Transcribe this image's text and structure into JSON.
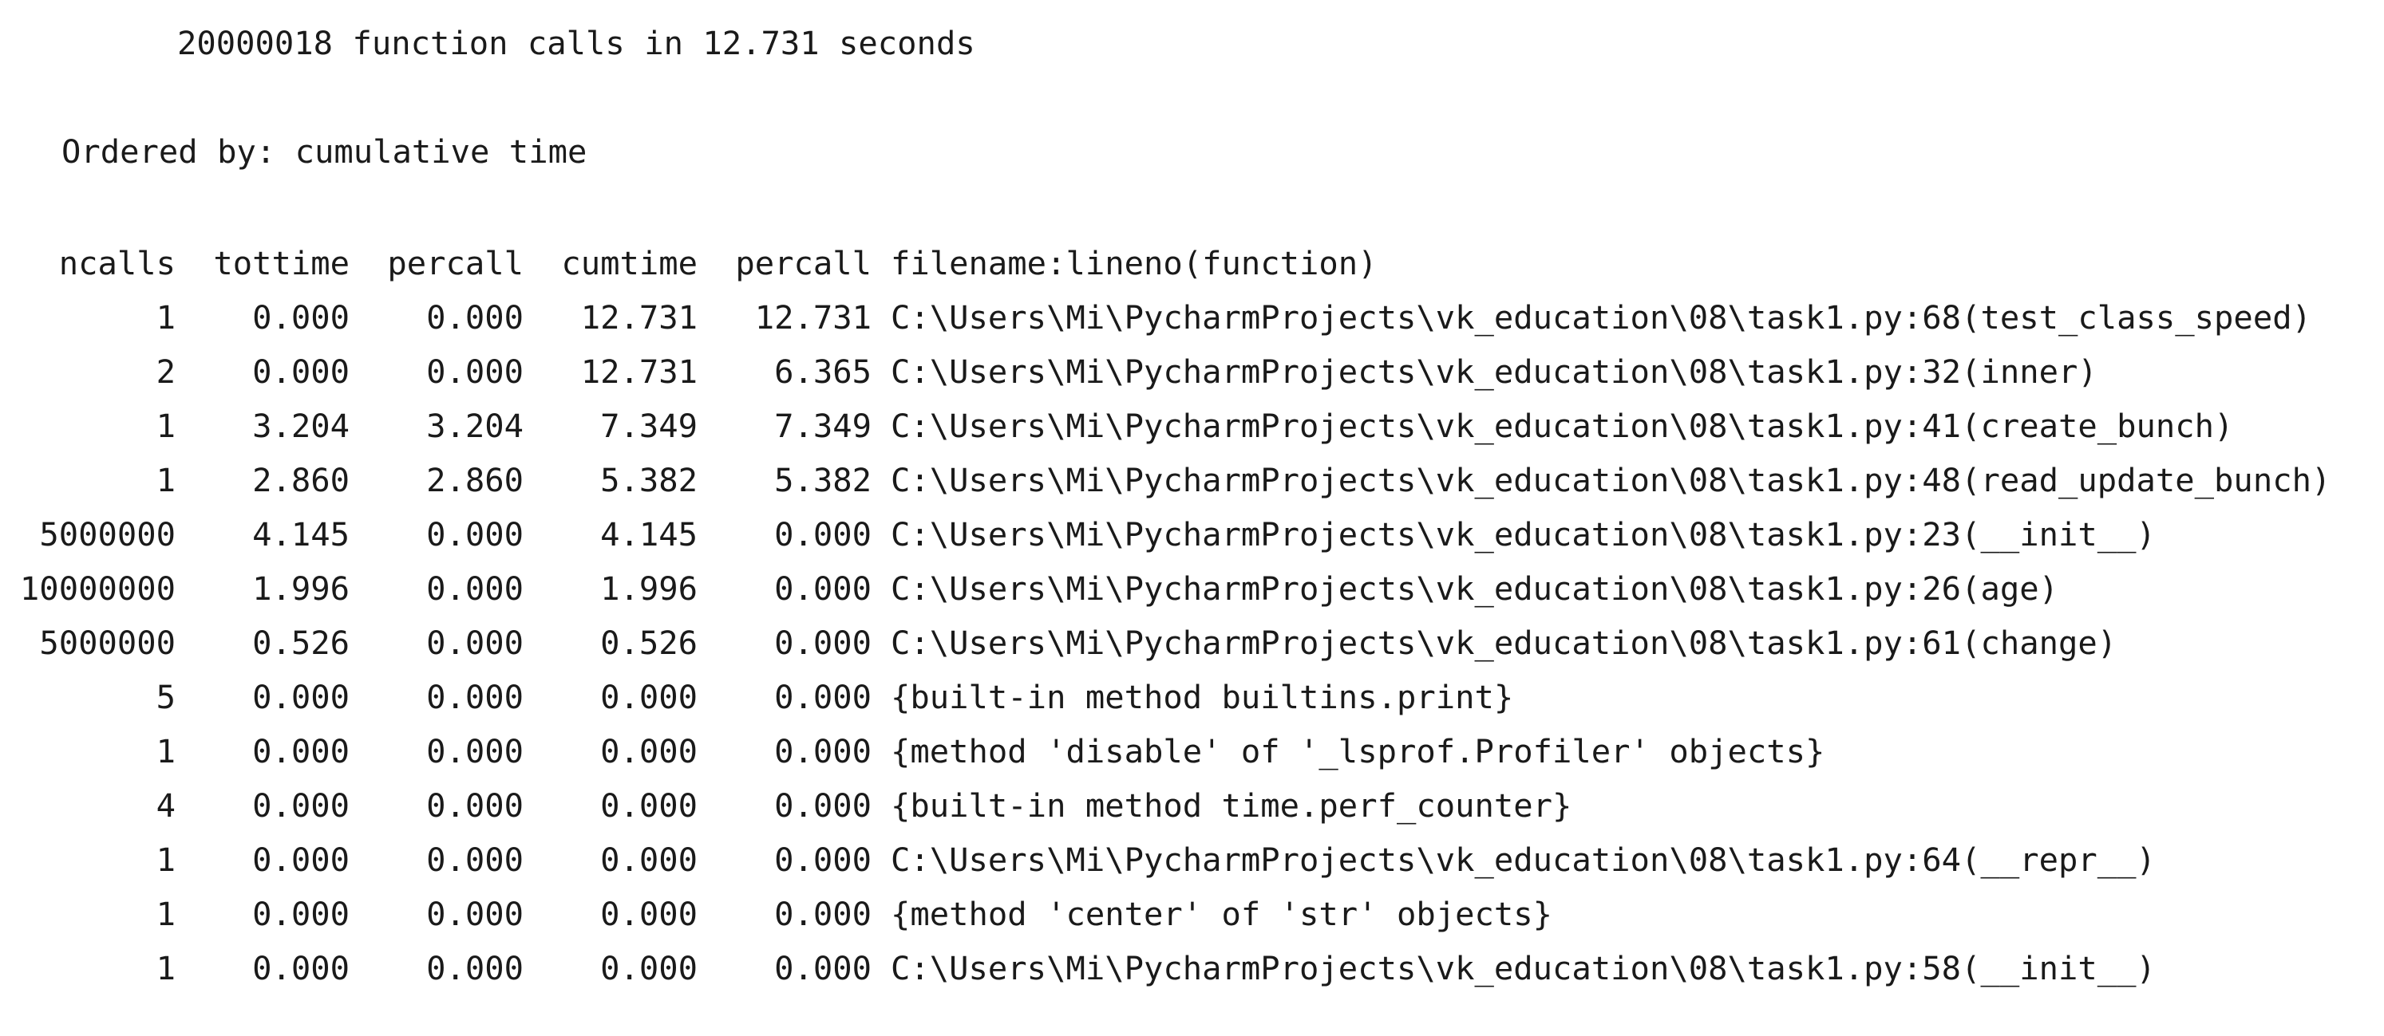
{
  "summary": {
    "text": "20000018 function calls in 12.731 seconds"
  },
  "ordered": {
    "text": "Ordered by: cumulative time"
  },
  "table": {
    "headers": [
      "ncalls",
      "tottime",
      "percall",
      "cumtime",
      "percall",
      "filename:lineno(function)"
    ],
    "rows": [
      [
        "1",
        "0.000",
        "0.000",
        "12.731",
        "12.731",
        "C:\\Users\\Mi\\PycharmProjects\\vk_education\\08\\task1.py:68(test_class_speed)"
      ],
      [
        "2",
        "0.000",
        "0.000",
        "12.731",
        "6.365",
        "C:\\Users\\Mi\\PycharmProjects\\vk_education\\08\\task1.py:32(inner)"
      ],
      [
        "1",
        "3.204",
        "3.204",
        "7.349",
        "7.349",
        "C:\\Users\\Mi\\PycharmProjects\\vk_education\\08\\task1.py:41(create_bunch)"
      ],
      [
        "1",
        "2.860",
        "2.860",
        "5.382",
        "5.382",
        "C:\\Users\\Mi\\PycharmProjects\\vk_education\\08\\task1.py:48(read_update_bunch)"
      ],
      [
        "5000000",
        "4.145",
        "0.000",
        "4.145",
        "0.000",
        "C:\\Users\\Mi\\PycharmProjects\\vk_education\\08\\task1.py:23(__init__)"
      ],
      [
        "10000000",
        "1.996",
        "0.000",
        "1.996",
        "0.000",
        "C:\\Users\\Mi\\PycharmProjects\\vk_education\\08\\task1.py:26(age)"
      ],
      [
        "5000000",
        "0.526",
        "0.000",
        "0.526",
        "0.000",
        "C:\\Users\\Mi\\PycharmProjects\\vk_education\\08\\task1.py:61(change)"
      ],
      [
        "5",
        "0.000",
        "0.000",
        "0.000",
        "0.000",
        "{built-in method builtins.print}"
      ],
      [
        "1",
        "0.000",
        "0.000",
        "0.000",
        "0.000",
        "{method 'disable' of '_lsprof.Profiler' objects}"
      ],
      [
        "4",
        "0.000",
        "0.000",
        "0.000",
        "0.000",
        "{built-in method time.perf_counter}"
      ],
      [
        "1",
        "0.000",
        "0.000",
        "0.000",
        "0.000",
        "C:\\Users\\Mi\\PycharmProjects\\vk_education\\08\\task1.py:64(__repr__)"
      ],
      [
        "1",
        "0.000",
        "0.000",
        "0.000",
        "0.000",
        "{method 'center' of 'str' objects}"
      ],
      [
        "1",
        "0.000",
        "0.000",
        "0.000",
        "0.000",
        "C:\\Users\\Mi\\PycharmProjects\\vk_education\\08\\task1.py:58(__init__)"
      ]
    ]
  }
}
